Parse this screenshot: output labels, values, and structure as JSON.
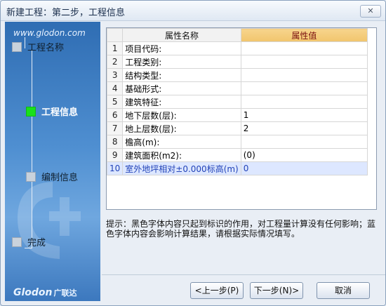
{
  "window": {
    "title": "新建工程：第二步，工程信息",
    "close_label": "✕"
  },
  "sidebar": {
    "site_url": "www.glodon.com",
    "steps": [
      {
        "label": "工程名称",
        "active": false
      },
      {
        "label": "工程信息",
        "active": true
      },
      {
        "label": "编制信息",
        "active": false
      },
      {
        "label": "完成",
        "active": false
      }
    ],
    "logo": {
      "brand": "Glodon",
      "chinese": "广联达"
    }
  },
  "grid": {
    "headers": {
      "name": "属性名称",
      "value": "属性值"
    },
    "rows": [
      {
        "idx": "1",
        "name": "项目代码:",
        "value": ""
      },
      {
        "idx": "2",
        "name": "工程类别:",
        "value": ""
      },
      {
        "idx": "3",
        "name": "结构类型:",
        "value": ""
      },
      {
        "idx": "4",
        "name": "基础形式:",
        "value": ""
      },
      {
        "idx": "5",
        "name": "建筑特征:",
        "value": ""
      },
      {
        "idx": "6",
        "name": "地下层数(层):",
        "value": "1"
      },
      {
        "idx": "7",
        "name": "地上层数(层):",
        "value": "2"
      },
      {
        "idx": "8",
        "name": "檐高(m):",
        "value": ""
      },
      {
        "idx": "9",
        "name": "建筑面积(m2):",
        "value": "(0)"
      },
      {
        "idx": "10",
        "name": "室外地坪相对±0.000标高(m)",
        "value": "0",
        "selected": true
      }
    ]
  },
  "hint": "提示：黑色字体内容只起到标识的作用，对工程量计算没有任何影响；蓝色字体内容会影响计算结果，请根据实际情况填写。",
  "buttons": {
    "prev": "<上一步(P)",
    "next": "下一步(N)>",
    "cancel": "取消"
  },
  "colors": {
    "sidebar_blue": "#4f8fd1",
    "active_step": "#19e11b",
    "value_header": "#f1c56d",
    "selected_row_text": "#2243b8"
  }
}
